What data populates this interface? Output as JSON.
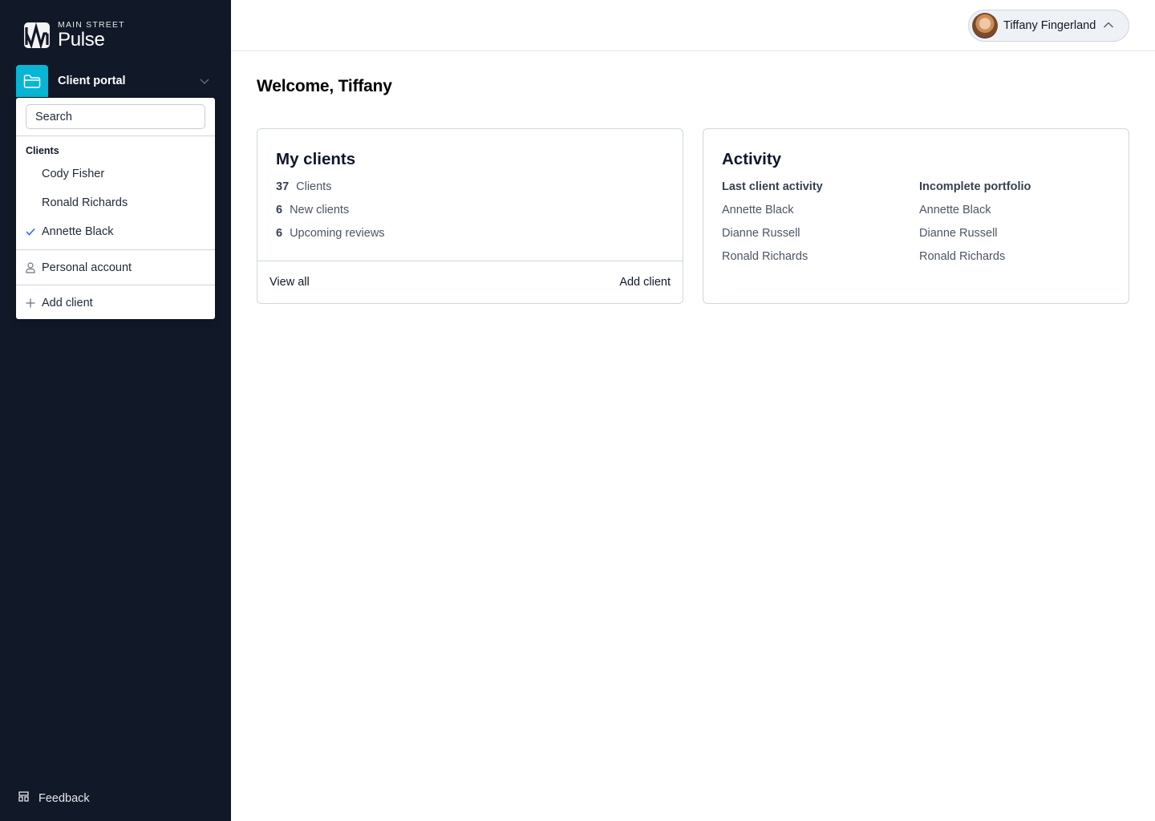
{
  "brand": {
    "small": "MAIN STREET",
    "big": "Pulse"
  },
  "portal": {
    "label": "Client portal",
    "icon": "folder-icon",
    "accent": "#06b6d4"
  },
  "dropdown": {
    "search_placeholder": "Search",
    "section_title": "Clients",
    "clients": [
      {
        "name": "Cody Fisher",
        "selected": false
      },
      {
        "name": "Ronald Richards",
        "selected": false
      },
      {
        "name": "Annette Black",
        "selected": true
      }
    ],
    "personal_account": "Personal account",
    "add_client": "Add client"
  },
  "sidebar_footer": {
    "feedback": "Feedback"
  },
  "user": {
    "name": "Tiffany Fingerland"
  },
  "main": {
    "welcome": "Welcome, Tiffany",
    "my_clients": {
      "title": "My clients",
      "stats": [
        {
          "value": "37",
          "label": "Clients"
        },
        {
          "value": "6",
          "label": "New clients"
        },
        {
          "value": "6",
          "label": "Upcoming reviews"
        }
      ],
      "view_all": "View all",
      "add_client": "Add client"
    },
    "activity": {
      "title": "Activity",
      "last_activity": {
        "heading": "Last client activity",
        "items": [
          "Annette Black",
          "Dianne Russell",
          "Ronald Richards"
        ]
      },
      "incomplete": {
        "heading": "Incomplete portfolio",
        "items": [
          "Annette Black",
          "Dianne Russell",
          "Ronald Richards"
        ]
      }
    }
  },
  "colors": {
    "sidebar_bg": "#111827",
    "check": "#2563eb"
  }
}
